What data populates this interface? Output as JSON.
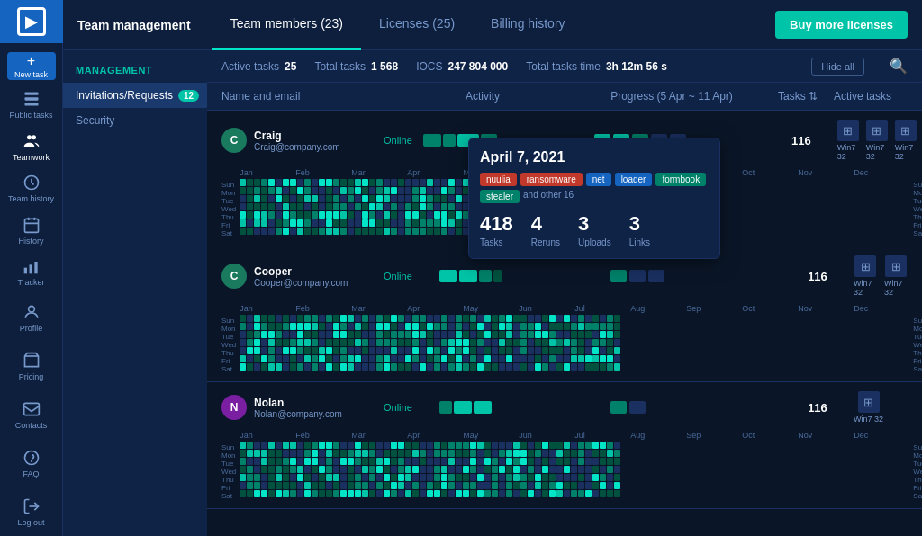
{
  "sidebar": {
    "logo": "▶",
    "items": [
      {
        "id": "new-task",
        "label": "New task",
        "icon": "+"
      },
      {
        "id": "public-tasks",
        "label": "Public tasks",
        "icon": "📋"
      },
      {
        "id": "teamwork",
        "label": "Teamwork",
        "icon": "👥",
        "active": true
      },
      {
        "id": "team-history",
        "label": "Team history",
        "icon": "🕐"
      },
      {
        "id": "history",
        "label": "History",
        "icon": "📅"
      },
      {
        "id": "tracker",
        "label": "Tracker",
        "icon": "📊"
      },
      {
        "id": "profile",
        "label": "Profile",
        "icon": "👤"
      },
      {
        "id": "pricing",
        "label": "Pricing",
        "icon": "🛒"
      },
      {
        "id": "contacts",
        "label": "Contacts",
        "icon": "✉"
      },
      {
        "id": "faq",
        "label": "FAQ",
        "icon": "?"
      },
      {
        "id": "log-out",
        "label": "Log out",
        "icon": "↩"
      }
    ]
  },
  "header": {
    "team_management": "Team management",
    "tabs": [
      {
        "id": "team-members",
        "label": "Team members (23)",
        "active": true
      },
      {
        "id": "licenses",
        "label": "Licenses (25)",
        "active": false
      },
      {
        "id": "billing",
        "label": "Billing history",
        "active": false
      }
    ],
    "buy_license_btn": "Buy more licenses"
  },
  "left_panel": {
    "title": "Management",
    "items": [
      {
        "id": "invitations",
        "label": "Invitations/Requests",
        "badge": "12",
        "active": true
      },
      {
        "id": "security",
        "label": "Security",
        "active": false
      }
    ]
  },
  "stats_bar": {
    "active_tasks_label": "Active tasks",
    "active_tasks_value": "25",
    "total_tasks_label": "Total tasks",
    "total_tasks_value": "1 568",
    "iocs_label": "IOCS",
    "iocs_value": "247 804 000",
    "total_tasks_time_label": "Total tasks time",
    "total_tasks_time_value": "3h 12m 56 s",
    "hide_all_btn": "Hide all"
  },
  "table_header": {
    "name_email": "Name and email",
    "activity": "Activity",
    "progress": "Progress (5 Apr ~ 11 Apr)",
    "tasks": "Tasks ⇅",
    "active_tasks": "Active tasks"
  },
  "tooltip": {
    "date": "April 7, 2021",
    "tags": [
      {
        "label": "nuulia",
        "color": "red"
      },
      {
        "label": "ransomware",
        "color": "red"
      },
      {
        "label": "net",
        "color": "blue"
      },
      {
        "label": "loader",
        "color": "blue"
      },
      {
        "label": "formbook",
        "color": "green"
      },
      {
        "label": "stealer",
        "color": "green"
      },
      {
        "label": "and other 16",
        "color": "none"
      }
    ],
    "stats": [
      {
        "value": "418",
        "label": "Tasks"
      },
      {
        "value": "4",
        "label": "Reruns"
      },
      {
        "value": "3",
        "label": "Uploads"
      },
      {
        "value": "3",
        "label": "Links"
      }
    ]
  },
  "members": [
    {
      "initial": "C",
      "name": "Craig",
      "email": "Craig@company.com",
      "status": "Online",
      "tasks": "116",
      "active_tasks": [
        "Win7 32",
        "Win7 32",
        "Win7 32"
      ]
    },
    {
      "initial": "C",
      "name": "Cooper",
      "email": "Cooper@company.com",
      "status": "Online",
      "tasks": "116",
      "active_tasks": [
        "Win7 32",
        "Win7 32"
      ]
    },
    {
      "initial": "N",
      "name": "Nolan",
      "email": "Nolan@company.com",
      "status": "Online",
      "tasks": "116",
      "active_tasks": [
        "Win7 32"
      ]
    }
  ],
  "months": [
    "Jan",
    "Feb",
    "Mar",
    "Apr",
    "May",
    "Jun",
    "Jul",
    "Aug",
    "Sep",
    "Oct",
    "Nov",
    "Dec"
  ],
  "days": [
    "Sun",
    "Mon",
    "Tue",
    "Wed",
    "Thu",
    "Fri",
    "Sat"
  ]
}
